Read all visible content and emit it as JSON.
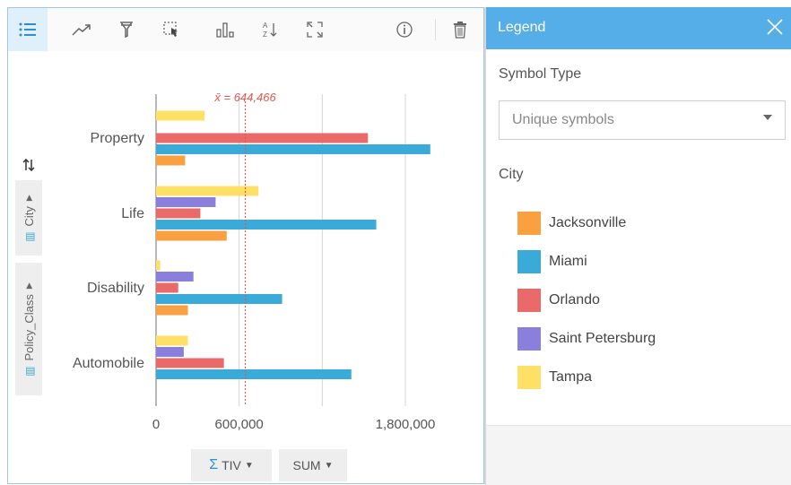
{
  "toolbar": {
    "buttons": [
      "list-icon",
      "trend-icon",
      "filter-icon",
      "select-icon",
      "bar-chart-icon",
      "sort-az-icon",
      "expand-icon",
      "info-icon",
      "trash-icon"
    ]
  },
  "side": {
    "city_label": "City",
    "policy_label": "Policy_Class"
  },
  "pills": {
    "tiv_label": "TIV",
    "sum_label": "SUM"
  },
  "legend": {
    "title": "Legend",
    "symbol_type_label": "Symbol Type",
    "symbol_type_value": "Unique symbols",
    "field_label": "City",
    "items": [
      {
        "label": "Jacksonville",
        "color": "#f9a040"
      },
      {
        "label": "Miami",
        "color": "#3aaad8"
      },
      {
        "label": "Orlando",
        "color": "#ea6a6a"
      },
      {
        "label": "Saint Petersburg",
        "color": "#8a7fdc"
      },
      {
        "label": "Tampa",
        "color": "#ffe066"
      }
    ]
  },
  "chart_data": {
    "type": "bar",
    "orientation": "horizontal",
    "categories": [
      "Property",
      "Life",
      "Disability",
      "Automobile"
    ],
    "series": [
      {
        "name": "Tampa",
        "color": "#ffe066",
        "values": [
          350000,
          740000,
          30000,
          230000
        ]
      },
      {
        "name": "Saint Petersburg",
        "color": "#8a7fdc",
        "values": [
          0,
          430000,
          270000,
          200000
        ]
      },
      {
        "name": "Orlando",
        "color": "#ea6a6a",
        "values": [
          1530000,
          320000,
          160000,
          490000
        ]
      },
      {
        "name": "Miami",
        "color": "#3aaad8",
        "values": [
          1980000,
          1590000,
          910000,
          1410000
        ]
      },
      {
        "name": "Jacksonville",
        "color": "#f9a040",
        "values": [
          210000,
          510000,
          230000,
          0
        ]
      }
    ],
    "xticks": [
      0,
      600000,
      1800000
    ],
    "xtick_labels": [
      "0",
      "600,000",
      "1,800,000"
    ],
    "gridlines": [
      600000,
      1200000,
      1800000
    ],
    "xlim": [
      0,
      2200000
    ],
    "mean": 644466,
    "mean_label": "x̄ = 644,466"
  }
}
